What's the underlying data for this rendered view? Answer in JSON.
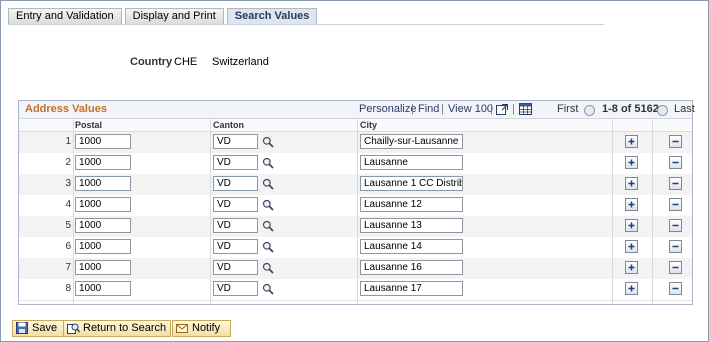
{
  "tabs": [
    {
      "label": "Entry and Validation",
      "active": false
    },
    {
      "label": "Display and Print",
      "active": false
    },
    {
      "label": "Search Values",
      "active": true
    }
  ],
  "country": {
    "label": "Country",
    "code": "CHE",
    "name": "Switzerland"
  },
  "grid": {
    "title": "Address Values",
    "toolbar": {
      "personalize": "Personalize",
      "find": "Find",
      "view": "View 100",
      "first": "First",
      "range": "1-8 of 5162",
      "last": "Last"
    },
    "columns": {
      "postal": "Postal",
      "canton": "Canton",
      "city": "City"
    },
    "rows": [
      {
        "num": "1",
        "postal": "1000",
        "canton": "VD",
        "city": "Chailly-sur-Lausanne"
      },
      {
        "num": "2",
        "postal": "1000",
        "canton": "VD",
        "city": "Lausanne"
      },
      {
        "num": "3",
        "postal": "1000",
        "canton": "VD",
        "city": "Lausanne 1 CC Distribi"
      },
      {
        "num": "4",
        "postal": "1000",
        "canton": "VD",
        "city": "Lausanne 12"
      },
      {
        "num": "5",
        "postal": "1000",
        "canton": "VD",
        "city": "Lausanne 13"
      },
      {
        "num": "6",
        "postal": "1000",
        "canton": "VD",
        "city": "Lausanne 14"
      },
      {
        "num": "7",
        "postal": "1000",
        "canton": "VD",
        "city": "Lausanne 16"
      },
      {
        "num": "8",
        "postal": "1000",
        "canton": "VD",
        "city": "Lausanne 17"
      }
    ]
  },
  "buttons": {
    "save": "Save",
    "return": "Return to Search",
    "notify": "Notify"
  },
  "colors": {
    "grid_title": "#c0702a",
    "accent": "#2b3a66"
  }
}
